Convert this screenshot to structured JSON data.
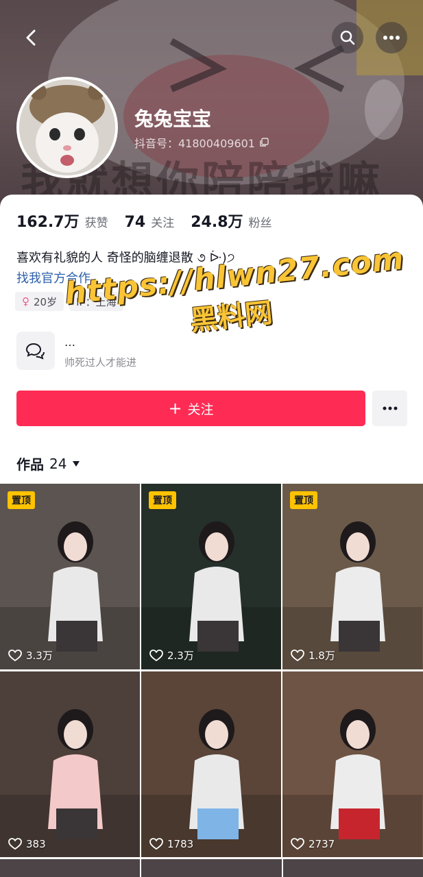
{
  "header": {
    "banner_text": "我就想你陪陪我嘛",
    "back_icon": "chevron-left-icon",
    "search_icon": "search-icon",
    "more_icon": "more-horizontal-icon"
  },
  "profile": {
    "nickname": "兔兔宝宝",
    "douyin_id": "抖音号：41800409601",
    "stats": [
      {
        "value": "162.7万",
        "label": "获赞"
      },
      {
        "value": "74",
        "label": "关注"
      },
      {
        "value": "24.8万",
        "label": "粉丝"
      }
    ],
    "bio": "喜欢有礼貌的人  奇怪的脑缠退散 ૭ ᐕ)੭",
    "bio_link": "找我官方合作",
    "tags": {
      "age": "20岁",
      "ip": "IP：上海"
    },
    "group": {
      "name": "…",
      "desc": "帅死过人才能进"
    },
    "follow_label": "关注"
  },
  "works": {
    "label": "作品",
    "count": "24",
    "tiles": [
      {
        "pinned": "置顶",
        "likes": "3.3万",
        "color": "#5b5450"
      },
      {
        "pinned": "置顶",
        "likes": "2.3万",
        "color": "#25302a"
      },
      {
        "pinned": "置顶",
        "likes": "1.8万",
        "color": "#6b5a4a"
      },
      {
        "pinned": "",
        "likes": "383",
        "color": "#4d403a"
      },
      {
        "pinned": "",
        "likes": "1783",
        "color": "#5a4538"
      },
      {
        "pinned": "",
        "likes": "2737",
        "color": "#6e5444"
      }
    ]
  },
  "watermark": {
    "line1": "https://hlwn27.com",
    "line2": "黑料网"
  },
  "colors": {
    "accent": "#fe2c55",
    "pin": "#ffc300",
    "link": "#2c5faa"
  }
}
